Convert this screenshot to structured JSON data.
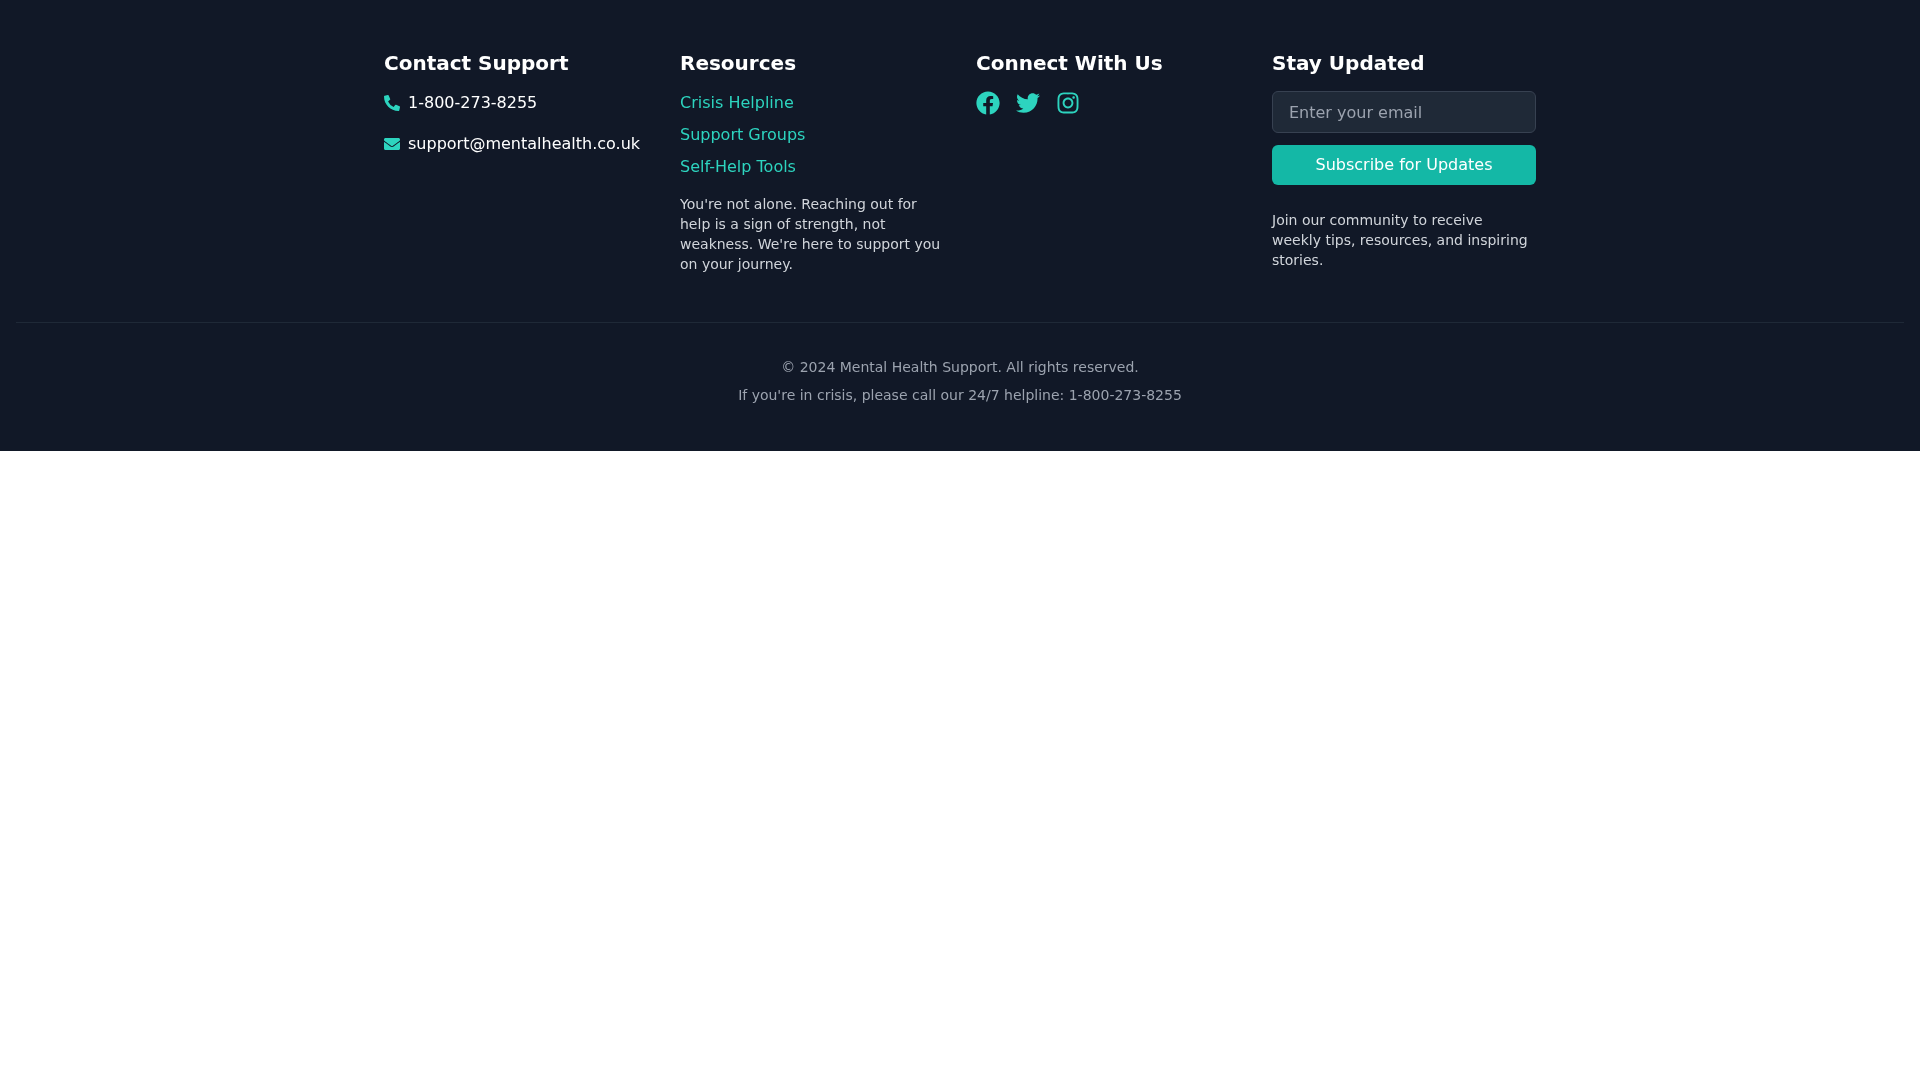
{
  "contact": {
    "heading": "Contact Support",
    "items": [
      {
        "kind": "phone",
        "text": "1-800-273-8255"
      },
      {
        "kind": "email",
        "text": "support@mentalhealth.co.uk"
      }
    ]
  },
  "resources": {
    "heading": "Resources",
    "links": [
      "Crisis Helpline",
      "Support Groups",
      "Self-Help Tools"
    ],
    "note": "You're not alone. Reaching out for help is a sign of strength, not weakness. We're here to support you on your journey."
  },
  "connect": {
    "heading": "Connect With Us",
    "socials": [
      {
        "kind": "facebook"
      },
      {
        "kind": "twitter"
      },
      {
        "kind": "instagram"
      }
    ]
  },
  "newsletter": {
    "heading": "Stay Updated",
    "email_placeholder": "Enter your email",
    "button": "Subscribe for Updates",
    "note": "Join our community to receive weekly tips, resources, and inspiring stories."
  },
  "bottom": {
    "copyright": "© 2024 Mental Health Support. All rights reserved.",
    "crisis_note": "If you're in crisis, please call our 24/7 helpline: 1-800-273-8255"
  }
}
